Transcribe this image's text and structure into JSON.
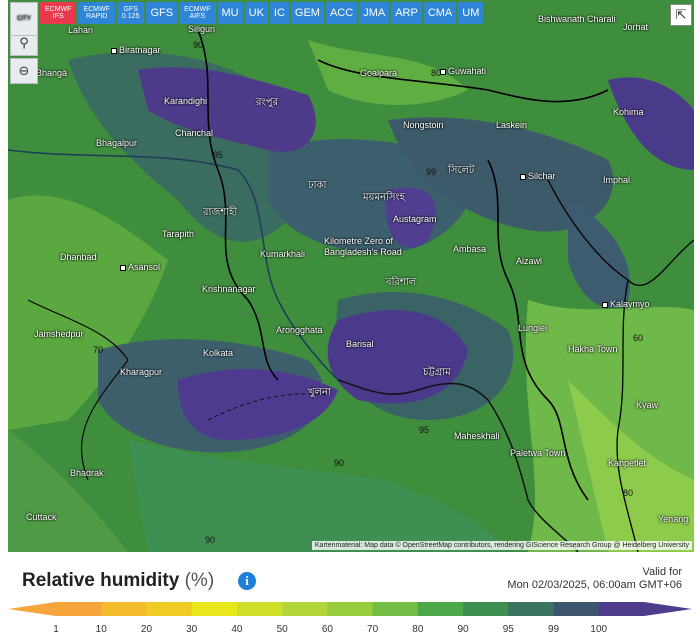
{
  "toolbar": {
    "reload_icon": "reload-icon",
    "location_icon": "pin-icon",
    "zoom_out_icon": "zoom-out-icon",
    "city_label": "CITY",
    "share_icon": "share-icon"
  },
  "models": [
    {
      "label_top": "ECMWF",
      "label_bottom": "IFS",
      "active": true
    },
    {
      "label_top": "ECMWF",
      "label_bottom": "RAPID",
      "active": false
    },
    {
      "label_top": "GFS",
      "label_bottom": "0.125",
      "active": false
    },
    {
      "label_top": "GFS",
      "label_bottom": "",
      "active": false
    },
    {
      "label_top": "ECMWF",
      "label_bottom": "AIFS",
      "active": false
    },
    {
      "label_top": "MU",
      "label_bottom": "",
      "active": false
    },
    {
      "label_top": "UK",
      "label_bottom": "",
      "active": false
    },
    {
      "label_top": "IC",
      "label_bottom": "",
      "active": false
    },
    {
      "label_top": "GEM",
      "label_bottom": "",
      "active": false
    },
    {
      "label_top": "ACC",
      "label_bottom": "",
      "active": false
    },
    {
      "label_top": "JMA",
      "label_bottom": "",
      "active": false
    },
    {
      "label_top": "ARP",
      "label_bottom": "",
      "active": false
    },
    {
      "label_top": "CMA",
      "label_bottom": "",
      "active": false
    },
    {
      "label_top": "UM",
      "label_bottom": "",
      "active": false
    }
  ],
  "cities": [
    {
      "name": "Lahan"
    },
    {
      "name": "Siliguri"
    },
    {
      "name": "Biratnagar"
    },
    {
      "name": "Goalpara"
    },
    {
      "name": "Guwahati"
    },
    {
      "name": "Bishwanath Charali"
    },
    {
      "name": "Jorhat"
    },
    {
      "name": "Karandighi"
    },
    {
      "name": "Nongstoin"
    },
    {
      "name": "Laskein"
    },
    {
      "name": "Kohima"
    },
    {
      "name": "Chanchal"
    },
    {
      "name": "Bhagalpur"
    },
    {
      "name": "Silchar"
    },
    {
      "name": "Imphal"
    },
    {
      "name": "Tarapith"
    },
    {
      "name": "Austagram"
    },
    {
      "name": "Dhanbad"
    },
    {
      "name": "Asansol"
    },
    {
      "name": "Kumarkhali"
    },
    {
      "name": "Kilometre Zero of Bangladesh's Road"
    },
    {
      "name": "Ambasa"
    },
    {
      "name": "Aizawl"
    },
    {
      "name": "Krishnanagar"
    },
    {
      "name": "Kalaymyo"
    },
    {
      "name": "Jamshedpur"
    },
    {
      "name": "Arongghata"
    },
    {
      "name": "Barisal"
    },
    {
      "name": "Lunglei"
    },
    {
      "name": "Hakha Town"
    },
    {
      "name": "Kolkata"
    },
    {
      "name": "Kharagpur"
    },
    {
      "name": "Kyaw"
    },
    {
      "name": "Maheskhali"
    },
    {
      "name": "Paletwa Town"
    },
    {
      "name": "Kanpetlet"
    },
    {
      "name": "Bhadrak"
    },
    {
      "name": "Cuttack"
    },
    {
      "name": "Yenang"
    },
    {
      "name": "Bhangà"
    }
  ],
  "regions": [
    {
      "name": "রংপুর"
    },
    {
      "name": "ময়মনসিংহ"
    },
    {
      "name": "সিলেট"
    },
    {
      "name": "রাজশাহী"
    },
    {
      "name": "ঢাকা"
    },
    {
      "name": "খুলনা"
    },
    {
      "name": "চট্টগ্রাম"
    },
    {
      "name": "বরিশাল"
    }
  ],
  "contour_labels": [
    "90",
    "95",
    "80",
    "70",
    "60",
    "99",
    "90",
    "95",
    "90",
    "80"
  ],
  "attribution": "Kartenmaterial: Map data © OpenStreetMap contributors, rendering GIScience Research Group @ Heidelberg University",
  "legend": {
    "title": "Relative humidity",
    "unit": "(%)",
    "info_icon": "info-icon",
    "valid_label": "Valid for",
    "valid_time": "Mon 02/03/2025, 06:00am GMT+06",
    "ticks": [
      "1",
      "10",
      "20",
      "30",
      "40",
      "50",
      "60",
      "70",
      "80",
      "90",
      "95",
      "99",
      "100"
    ],
    "colors": [
      "#f6a53a",
      "#f4bb2e",
      "#eecb25",
      "#e9e61b",
      "#cfe02a",
      "#b2d63a",
      "#97cc3f",
      "#74bd44",
      "#4da84a",
      "#3f8e52",
      "#3b7361",
      "#3d566e",
      "#4f3c8c"
    ]
  }
}
